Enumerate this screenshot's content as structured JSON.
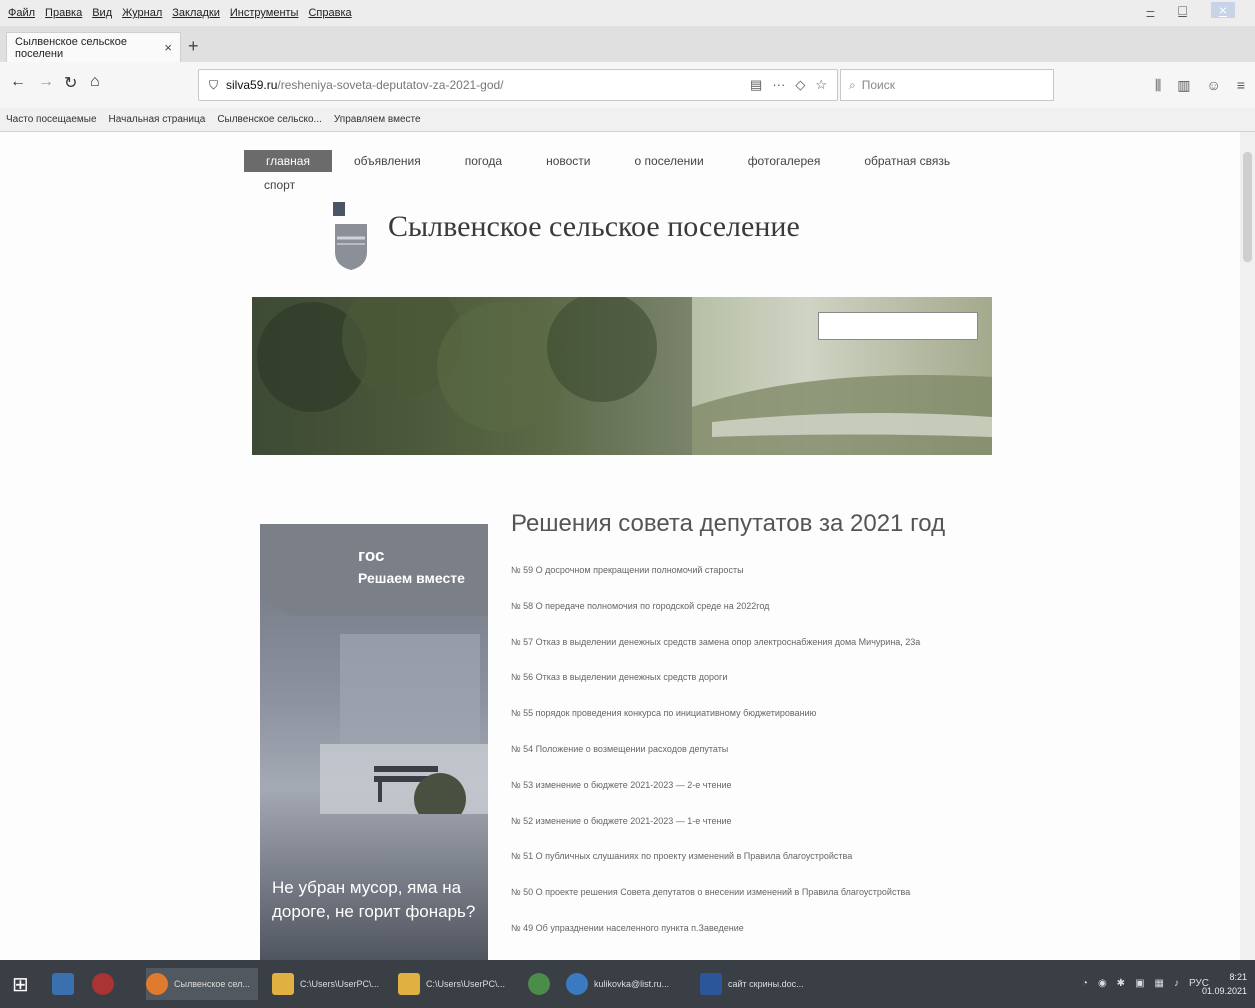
{
  "menubar": {
    "items": [
      "Файл",
      "Правка",
      "Вид",
      "Журнал",
      "Закладки",
      "Инструменты",
      "Справка"
    ]
  },
  "tabs": [
    {
      "title": "Сылвенское сельское поселени"
    }
  ],
  "nav": {
    "url_host": "silva59.ru",
    "url_path": "/resheniya-soveta-deputatov-za-2021-god/",
    "search_placeholder": "Поиск",
    "more_label": "···"
  },
  "bookmarks": [
    "Часто посещаемые",
    "Начальная страница",
    "Сылвенское сельско...",
    "Управляем вместе"
  ],
  "site": {
    "menu": [
      "главная",
      "объявления",
      "погода",
      "новости",
      "о поселении",
      "фотогалерея",
      "обратная связь"
    ],
    "menu_extra": "спорт",
    "title": "Сылвенское сельское поселение"
  },
  "promo": {
    "brand": "гос",
    "slogan": "Решаем вместе",
    "text": "Не убран мусор, яма на дороге, не горит фонарь?"
  },
  "content": {
    "heading": "Решения совета депутатов за 2021 год",
    "documents": [
      "№ 59 О досрочном прекращении полномочий старосты",
      "№ 58 О передаче полномочия по городской среде на 2022год",
      "№ 57 Отказ в выделении денежных средств замена опор электроснабжения дома Мичурина, 23а",
      "№ 56 Отказ в выделении денежных средств дороги",
      "№ 55 порядок проведения конкурса по инициативному бюджетированию",
      "№ 54 Положение о возмещении расходов депутаты",
      "№ 53 изменение о бюджете 2021-2023 — 2-е чтение",
      "№ 52 изменение о бюджете 2021-2023 — 1-е чтение",
      "№ 51 О публичных слушаниях по проекту изменений в Правила благоустройства",
      "№ 50 О проекте решения Совета депутатов о внесении изменений в Правила благоустройства",
      "№ 49 Об упразднении населенного пункта п.Заведение"
    ]
  },
  "taskbar": {
    "items": [
      "Сылвенское сел...",
      "C:\\Users\\UserPC\\...",
      "C:\\Users\\UserPC\\...",
      "kulikovka@list.ru...",
      "сайт скрины.doc..."
    ],
    "lang": "РУС",
    "time": "8:21",
    "date": "01.09.2021"
  }
}
